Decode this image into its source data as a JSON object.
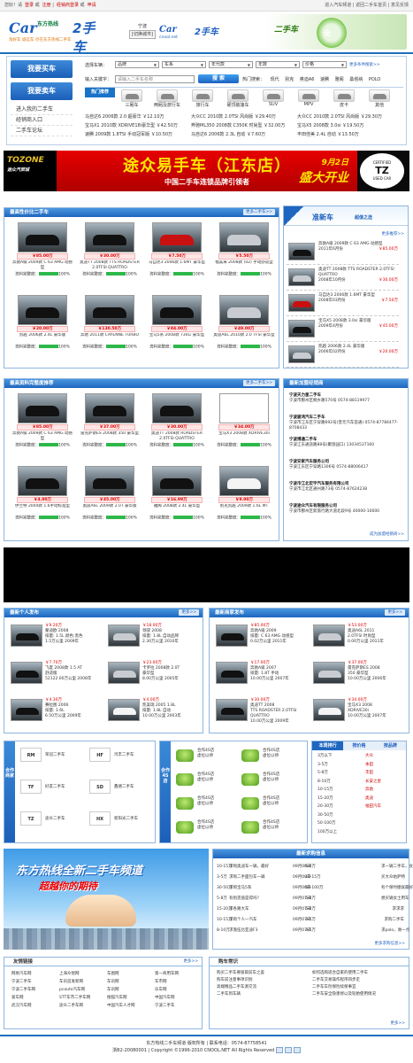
{
  "topbar": {
    "greeting": "您好！请",
    "login": "登录",
    "or": "或",
    "register": "注册",
    "dealer_login": "经销商登录",
    "or2": "或",
    "apply": "申请",
    "links": [
      "进入汽车频道",
      "返回二手车首页",
      "意见反馈"
    ]
  },
  "header": {
    "logo_car": "Car",
    "logo_cn": "东方热线",
    "logo_big": "2手车",
    "logo_url": "cnool.net",
    "slogan": "淘好车  诚信车  尽在东方热线二手车",
    "city": "宁波",
    "city_switch": "[切换城市]",
    "logo2_car": "Car",
    "logo2_big": "2手车",
    "logo2_url": "cnool.net",
    "banner_text1": "二手车",
    "banner_text2": "全"
  },
  "search": {
    "buy_btn": "我要买车",
    "sell_btn": "我要卖车",
    "left_links": [
      "进入我的二手车",
      "经销商入口",
      "二手车论坛"
    ],
    "label_type": "选择车辆：",
    "selects": [
      "品牌",
      "车系",
      "年代款",
      "年数",
      "价格"
    ],
    "more_link": "更多条件搜索>>",
    "label_keyword": "输入关键字：",
    "keyword_placeholder": "请输入二手车名称",
    "search_btn": "搜 索",
    "hot_label": "热门搜索：",
    "hot": [
      "现代",
      "别克",
      "奥迪A6",
      "速腾",
      "雅阁",
      "桑塔纳",
      "POLO"
    ],
    "hot_tab": "热门推荐",
    "categories": [
      "三厢车",
      "两厢及旅行车",
      "旅行车",
      "硬顶敞篷车",
      "SUV",
      "MPV",
      "皮卡",
      "其他"
    ]
  },
  "news": [
    [
      "马自达6 2006款 2.0 超豪华 ￥12.10万",
      "大众CC 2010款 2.0TSI 风尚版 ￥29.40万",
      "大众CC 2010款 2.0TSI 风尚版 ￥29.30万"
    ],
    [
      "宝马X1 2010款 XDRIVE18i豪华型 ￥42.50万",
      "奔驰ML350 2008款 C350K 时尚型 ￥32.00万",
      "宝马X5 2008款 3.0si ￥19.50万"
    ],
    [
      "速腾 2009款 1.8TSI 手动冠军版 ￥10.50万",
      "马自达6 2006款 2.3L 自动 ￥7.60万",
      "丰田佳美 2.4L 自动 ￥13.50万"
    ]
  ],
  "ad": {
    "brand": "TOZONE",
    "brand_sub": "途众汽贸城",
    "title": "途众易手车（江东店）",
    "subtitle": "中国二手车连锁品牌引领者",
    "date": "9月2日",
    "opening": "盛大开业",
    "cert_top": "CERTIFIED",
    "cert_logo": "TZ",
    "cert_bottom": "USED CAR"
  },
  "section1": {
    "title": "最高性价比二手车",
    "more": "更多二手车>>",
    "cars": [
      {
        "price": "￥85.00万",
        "desc": "奔驰A级 2009款 C 63 AMG 动感型",
        "tag": "资料完整度："
      },
      {
        "price": "￥30.00万",
        "desc": "奥迪TT 2008款 TTS ROADSTER 2.0TFSI QUATTRO",
        "tag": "资料完整度："
      },
      {
        "price": "￥7.50万",
        "desc": "马自达3 2006款 1.6MT 豪华型",
        "tag": "资料完整度："
      },
      {
        "price": "￥5.50万",
        "desc": "福美来 2008款 (02) 手动舒适型",
        "tag": "资料完整度："
      },
      {
        "price": "￥20.00万",
        "desc": "凯越 2006款 2.4L 豪华版",
        "tag": "资料完整度："
      },
      {
        "price": "￥130.50万",
        "desc": "奔驰 2011款 CAYENNE TURBO",
        "tag": "资料完整度："
      },
      {
        "price": "￥84.00万",
        "desc": "宝马5系 2008款 730Li 豪华型",
        "tag": "资料完整度："
      },
      {
        "price": "￥49.00万",
        "desc": "奥迪A6L 2010款 2.0 TFSI 豪华型",
        "tag": "资料完整度："
      }
    ],
    "completeness": "100%"
  },
  "newcar": {
    "title": "准新车",
    "subtitle": "超值之选",
    "more": "更多推荐>>",
    "items": [
      {
        "desc": "奔驰A级 2009款 C 63 AMG 动感型",
        "date": "2011年6月份",
        "price": "￥85.00万"
      },
      {
        "desc": "奥迪TT 2008款 TTS ROADSTER 2.0TFSI QUATTRO",
        "date": "2008年10月份",
        "price": "￥30.00万"
      },
      {
        "desc": "马自达3 2006款 1.6MT 豪华型",
        "date": "2008年03月份",
        "price": "￥7.50万"
      },
      {
        "desc": "宝马X5 2008款 3.0si 豪华版",
        "date": "2009年4月份",
        "price": "￥45.00万"
      },
      {
        "desc": "凯越 2006款 2.4L 豪华版",
        "date": "2006年02月份",
        "price": "￥20.00万"
      }
    ]
  },
  "section2": {
    "title": "最高资料完整度推荐",
    "more": "更多二手车>>",
    "cars": [
      {
        "price": "￥85.00万",
        "desc": "奔驰A级 2009款 C 63 AMG 动感型"
      },
      {
        "price": "￥37.00万",
        "desc": "雷克萨斯ES 2008款 350 豪华型"
      },
      {
        "price": "￥30.00万",
        "desc": "奥迪TT 2008款 ROADSTER 2.0TFSI QUATTRO"
      },
      {
        "price": "￥34.00万",
        "desc": "宝马X3 2008款 XDRIVE30i"
      },
      {
        "price": "￥4.00万",
        "desc": "伊兰特 2004款 1.6手动标准型"
      },
      {
        "price": "￥45.00万",
        "desc": "奥迪A6L 2009款 2.0T 豪华版"
      },
      {
        "price": "￥16.99万",
        "desc": "雅阁 2008款 2.4L 豪华型"
      },
      {
        "price": "￥9.00万",
        "desc": "别克凯越 2009款 1.6L MT"
      }
    ],
    "completeness": "100%"
  },
  "dealers": {
    "title": "最新加盟经销商",
    "more": "成为加盟经销商>>",
    "items": [
      {
        "name": "宁波天力星二手车",
        "addr": "宁波市鄞州区桐乡路570号 0574-88119977"
      },
      {
        "name": "宁波骏鸿汽车二手车",
        "addr": "宁波市江东区宁穿路692号(普元汽车首通) 0574-87784477-8708433"
      },
      {
        "name": "宁波博通二手车",
        "addr": "宁波江东通途路88号(聚恩园口) 13034537160"
      },
      {
        "name": "宁波安家汽车服务公司",
        "addr": "宁波江东区宁穿路1306号 0574-88006417"
      },
      {
        "name": "宁波市江北宏宇汽车服务有限公司",
        "addr": "宁波市江北区通州路73号 0574-87624238"
      },
      {
        "name": "宁波途众汽车有限服务公司",
        "addr": "宁波市鄞州区新旅行路大道北段9号 40000-10000"
      }
    ]
  },
  "personal": {
    "title": "最新个人发布",
    "more": "更多>>",
    "items": [
      {
        "price": "￥9.20万",
        "name": "蒙迪欧 2008",
        "spec": "排量: 1.5L 颜色:黑色",
        "info": "1.5万公里  2009年"
      },
      {
        "price": "￥18.00万",
        "name": "领驭 2008",
        "spec": "排量: 1.8L 自动品牌",
        "info": "2.30万公里 2010年"
      },
      {
        "price": "￥7.70万",
        "name": "飞度 2008款 1.5 AT",
        "spec": "舒适版",
        "info": "52122.00万公里 2008年"
      },
      {
        "price": "￥23.00万",
        "name": "卡罗拉 2008款 2.0T",
        "spec": "豪华型",
        "info": "8.00万公里 2005年"
      },
      {
        "price": "￥4.30万",
        "name": "赛拉图 2006",
        "spec": "排量: 1.6L",
        "info": "6.50万公里 2009年"
      },
      {
        "price": "￥4.00万",
        "name": "凯美瑞 2005 1.8L",
        "spec": "排量: 1.8L 自动",
        "info": "10.00万公里 2003年"
      }
    ]
  },
  "merchant": {
    "title": "最新商家发布",
    "more": "更多>>",
    "items": [
      {
        "price": "￥85.00万",
        "name": "奔驰A级 2009",
        "spec": "排量: C 63 AMG 动感型",
        "info": "0.02万公里 2011年"
      },
      {
        "price": "￥53.00万",
        "name": "奥迪A6L 2011",
        "spec": "2.0TFSI 时尚型",
        "info": "0.00万公里 2011年"
      },
      {
        "price": "￥17.00万",
        "name": "奔驰A级 2007",
        "spec": "排量: 1.8T 手动",
        "info": "10.00万公里 2007年"
      },
      {
        "price": "￥37.00万",
        "name": "雷克萨斯ES 2008",
        "spec": "350 豪华型",
        "info": "10.00万公里 2006年"
      },
      {
        "price": "￥30.00万",
        "name": "奥迪TT 2008",
        "spec": "TTS ROADSTER 2.0TFSI QUATTRO",
        "info": "10.00万公里 2009年"
      },
      {
        "price": "￥34.00万",
        "name": "宝马X3 2008",
        "spec": "XDRIVE30i",
        "info": "10.00万公里 2007年"
      }
    ]
  },
  "partners": {
    "side_label": "合作商家",
    "items": [
      {
        "logo": "RM",
        "name": "荣冠二手车"
      },
      {
        "logo": "HF",
        "name": "鸿丰二手车"
      },
      {
        "logo": "TF",
        "name": "好友二手车"
      },
      {
        "logo": "SD",
        "name": "鑫德二手车"
      },
      {
        "logo": "TZ",
        "name": "途众二手车"
      },
      {
        "logo": "HX",
        "name": "新阳光二手车"
      }
    ]
  },
  "shop4s": {
    "side_label": "合作4S店",
    "items": [
      {
        "a": "合作4S店",
        "b": "虚位以待"
      },
      {
        "a": "合作4S店",
        "b": "虚位以待"
      },
      {
        "a": "合作4S店",
        "b": "虚位以待"
      },
      {
        "a": "合作4S店",
        "b": "虚位以待"
      },
      {
        "a": "合作4S店",
        "b": "虚位以待"
      },
      {
        "a": "合作4S店",
        "b": "虚位以待"
      },
      {
        "a": "合作4S店",
        "b": "虚位以待"
      },
      {
        "a": "合作4S店",
        "b": "虚位以待"
      }
    ]
  },
  "ranking": {
    "tabs": [
      "本周排行",
      "按价格",
      "按品牌"
    ],
    "prices": [
      "3万以下",
      "3-5万",
      "5-8万",
      "8-10万",
      "10-15万",
      "15-20万",
      "20-30万",
      "30-50万",
      "50-100万",
      "100万以上"
    ],
    "brands": [
      "大众",
      "本田",
      "丰田",
      "长安之星",
      "奔驰",
      "奥迪",
      "福田汽车"
    ]
  },
  "promo": {
    "t1": "东方热线全新二手车频道",
    "t2": "超越你的期待"
  },
  "buy": {
    "title": "最新求购信息",
    "more": "更多求购信息>>",
    "rows": [
      [
        "10-15万",
        "求购奥迪车一辆，最好",
        "09月08日",
        "5-8万",
        "求一辆二手车，女士开",
        "09月08日"
      ],
      [
        "3-5万",
        "求购二手面包车一辆",
        "09月08日",
        "10-15万",
        "买大众帕萨特",
        "09月08日"
      ],
      [
        "30-50万",
        "求购宝马5系",
        "09月08日",
        "50-100万",
        "有个保时捷就最好",
        "09月07日"
      ],
      [
        "5-8万",
        "有别克值是得吗?",
        "09月07日",
        "5-8万",
        "想买辆女士用车",
        "09月07日"
      ],
      [
        "15-20万",
        "求各路大车",
        "09月07日",
        "5-8万",
        "求求求",
        "09月07日"
      ],
      [
        "10-15万",
        "求购个人一汽车",
        "09月07日",
        "3-5万",
        "求购二手车",
        "09月06日"
      ],
      [
        "8-10万",
        "求落伍比亚迪F3",
        "09月07日",
        "3-5万",
        "求polo，谢一点",
        "09月06日"
      ]
    ]
  },
  "links": {
    "title": "友情链接",
    "more": "更多>>",
    "items": [
      "网易汽车网",
      "上海众悦网",
      "车图网",
      "第一商用车网",
      "宁波二手车",
      "车讯首发新网",
      "车讯网",
      "车市网",
      "宁波二手车网",
      "pcauto汽车网",
      "车讯网",
      "乐车网",
      "爱车网",
      "STT车市二手车网",
      "搜狐汽车网",
      "中国汽车网",
      "武汉汽车网",
      "途众二手车网",
      "中国汽车人才网",
      "宁波二手车"
    ]
  },
  "notice": {
    "title": "购车常识",
    "more": "更多>>",
    "items": [
      "购买二手车要吸取前车之鉴",
      "如何选购适合自家的使用二手车",
      "购车前注意事项识别",
      "二手车交易操作程序四步走",
      "高端精品二手车源交流",
      "二手车车险保险续保事宜",
      "二手车到车辆",
      "二手车安全隐患修以及轮胎使用情况"
    ]
  },
  "footer": {
    "line1": "东方热线二手车频道 版权所有 | 联系电话：0574-87758541",
    "line2": "浙B2-20080001 | Copyright ©1996-2010 CNOOL.NET All Rights Reserved"
  }
}
